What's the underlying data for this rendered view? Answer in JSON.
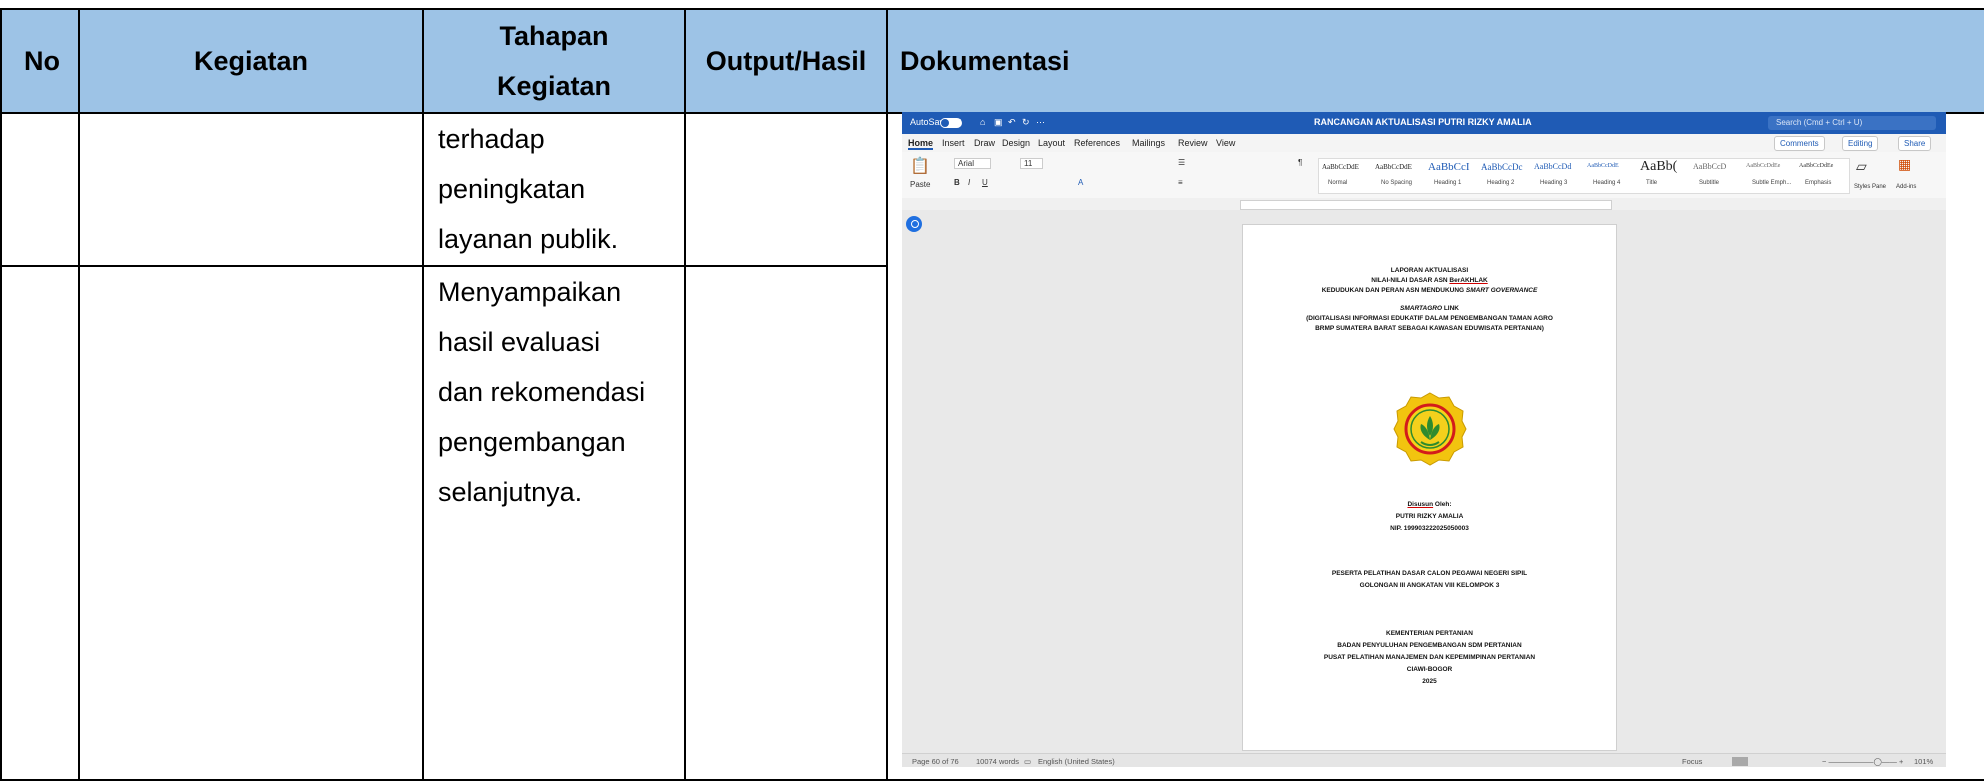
{
  "table": {
    "headers": {
      "no": "No",
      "kegiatan": "Kegiatan",
      "tahapan_line1": "Tahapan",
      "tahapan_line2": "Kegiatan",
      "output": "Output/Hasil",
      "dokumentasi": "Dokumentasi"
    },
    "row1": {
      "tahapan_lines": [
        "terhadap",
        "peningkatan",
        "layanan publik."
      ]
    },
    "row2": {
      "tahapan_lines": [
        "Menyampaikan",
        "hasil evaluasi",
        "dan rekomendasi",
        "pengembangan",
        "selanjutnya."
      ]
    }
  },
  "word": {
    "autosave": "AutoSave",
    "autosave_state": "OFF",
    "doc_title": "RANCANGAN AKTUALISASI PUTRI RIZKY AMALIA",
    "search_placeholder": "Search (Cmd + Ctrl + U)",
    "menu": [
      "Home",
      "Insert",
      "Draw",
      "Design",
      "Layout",
      "References",
      "Mailings",
      "Review",
      "View"
    ],
    "comments_btn": "Comments",
    "editing_btn": "Editing",
    "share_btn": "Share",
    "paste_label": "Paste",
    "font_name": "Arial",
    "font_size": "11",
    "styles": [
      {
        "preview": "AaBbCcDdE",
        "name": "Normal"
      },
      {
        "preview": "AaBbCcDdE",
        "name": "No Spacing"
      },
      {
        "preview": "AaBbCcI",
        "name": "Heading 1"
      },
      {
        "preview": "AaBbCcDc",
        "name": "Heading 2"
      },
      {
        "preview": "AaBbCcDd",
        "name": "Heading 3"
      },
      {
        "preview": "AaBbCcDdE",
        "name": "Heading 4"
      },
      {
        "preview": "AaBb(",
        "name": "Title"
      },
      {
        "preview": "AaBbCcD",
        "name": "Subtitle"
      },
      {
        "preview": "AaBbCcDdEe",
        "name": "Subtle Emph..."
      },
      {
        "preview": "AaBbCcDdEe",
        "name": "Emphasis"
      }
    ],
    "styles_pane": "Styles Pane",
    "addins": "Add-ins",
    "page_lines": {
      "l1": "LAPORAN AKTUALISASI",
      "l2a": "NILAI-NILAI DASAR ASN ",
      "l2b": "BerAKHLAK",
      "l3a": "KEDUDUKAN DAN PERAN ASN MENDUKUNG ",
      "l3b": "SMART GOVERNANCE",
      "l4a": "SMARTAGRO",
      "l4b": " LINK",
      "l5": "(DIGITALISASI INFORMASI EDUKATIF DALAM PENGEMBANGAN TAMAN AGRO",
      "l6": "BRMP SUMATERA BARAT SEBAGAI KAWASAN EDUWISATA PERTANIAN)",
      "l7a": "Disusun",
      "l7b": " Oleh:",
      "l8": "PUTRI RIZKY AMALIA",
      "l9": "NIP. 199903222025050003",
      "l10": "PESERTA PELATIHAN DASAR CALON PEGAWAI NEGERI SIPIL",
      "l11": "GOLONGAN III ANGKATAN VIII KELOMPOK 3",
      "l12": "KEMENTERIAN PERTANIAN",
      "l13": "BADAN PENYULUHAN PENGEMBANGAN SDM PERTANIAN",
      "l14": "PUSAT PELATIHAN MANAJEMEN DAN KEPEMIMPINAN PERTANIAN",
      "l15": "CIAWI-BOGOR",
      "l16": "2025"
    },
    "status": {
      "page": "Page 60 of 76",
      "words": "10074 words",
      "language": "English (United States)",
      "focus": "Focus",
      "zoom": "101%"
    }
  }
}
